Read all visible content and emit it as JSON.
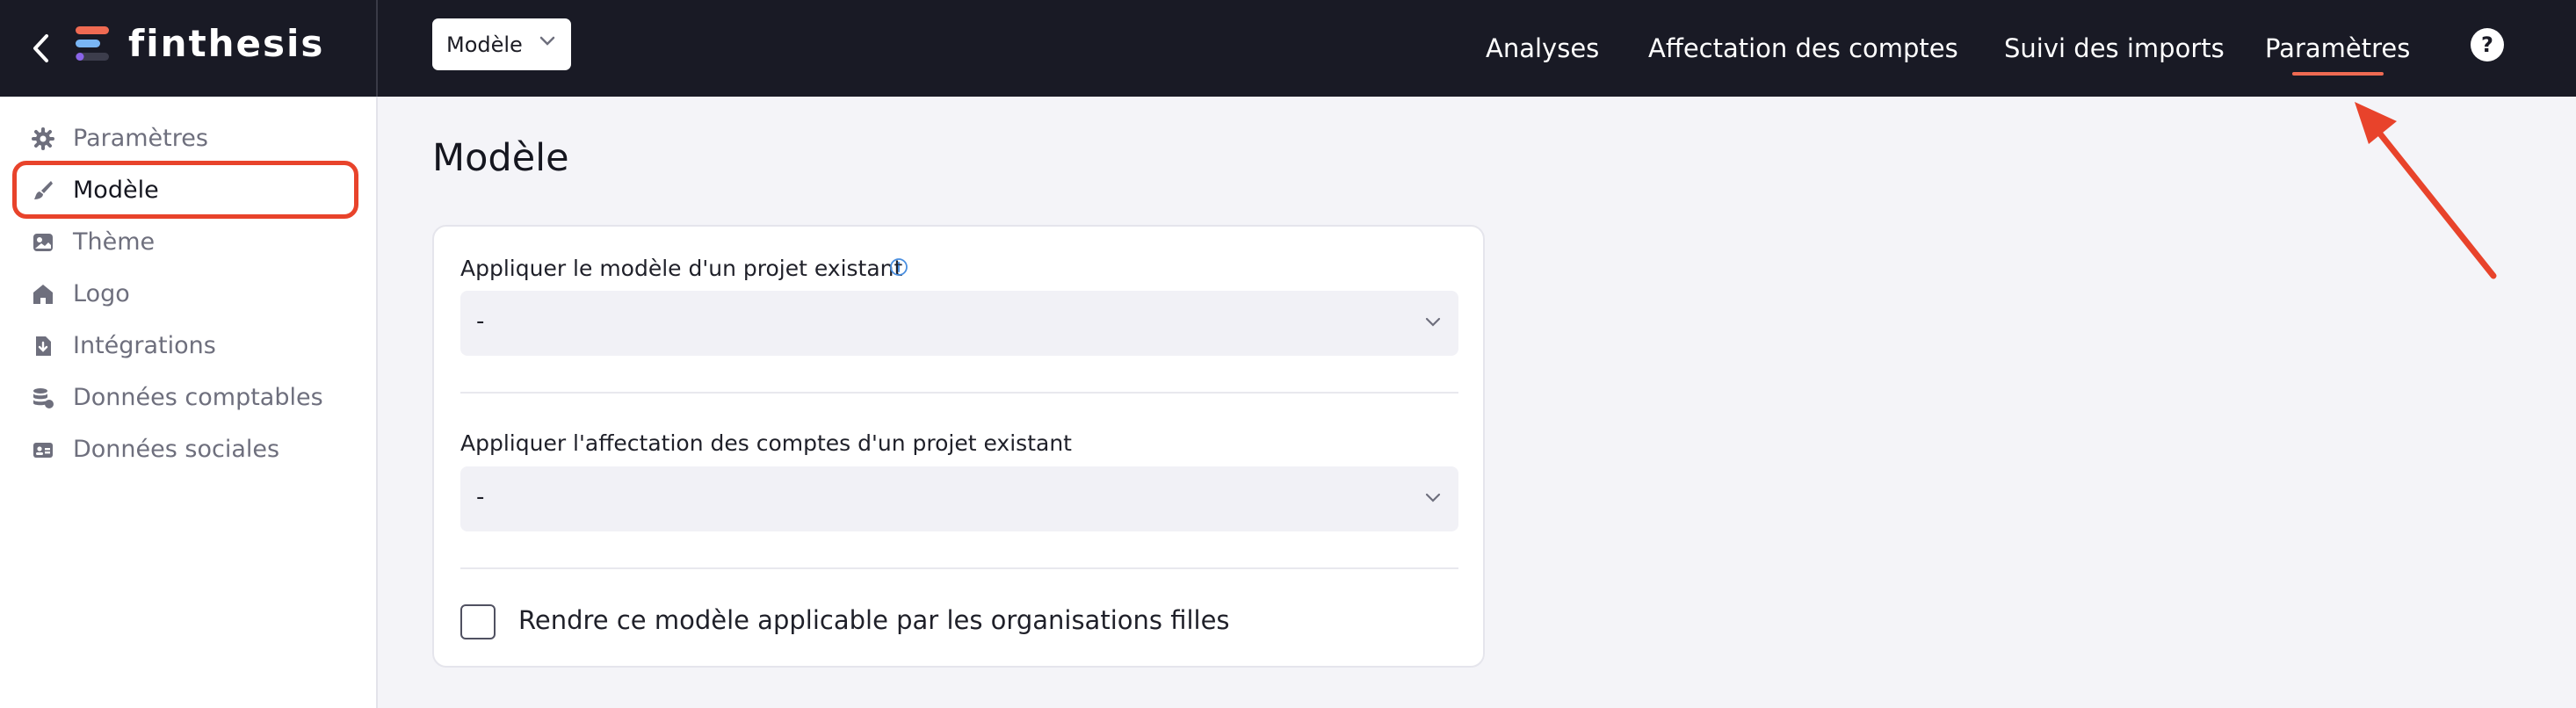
{
  "brand": {
    "name": "finthesis"
  },
  "header": {
    "model_select": "Modèle",
    "nav": [
      {
        "label": "Analyses"
      },
      {
        "label": "Affectation des comptes"
      },
      {
        "label": "Suivi des imports"
      },
      {
        "label": "Paramètres",
        "active": true
      }
    ],
    "help": "?"
  },
  "sidebar": {
    "items": [
      {
        "label": "Paramètres",
        "icon": "gear-icon"
      },
      {
        "label": "Modèle",
        "icon": "brush-icon",
        "active": true
      },
      {
        "label": "Thème",
        "icon": "image-icon"
      },
      {
        "label": "Logo",
        "icon": "home-icon"
      },
      {
        "label": "Intégrations",
        "icon": "download-file-icon"
      },
      {
        "label": "Données comptables",
        "icon": "database-icon"
      },
      {
        "label": "Données sociales",
        "icon": "id-card-icon"
      }
    ]
  },
  "main": {
    "title": "Modèle",
    "apply_model": {
      "label": "Appliquer le modèle d'un projet existant",
      "value": "-"
    },
    "apply_accounts": {
      "label": "Appliquer l'affectation des comptes d'un projet existant",
      "value": "-"
    },
    "checkbox": {
      "label": "Rendre ce modèle applicable par les organisations filles",
      "checked": false
    }
  },
  "colors": {
    "topbar": "#191a25",
    "accent": "#ef6a52",
    "annotation": "#e8432b"
  }
}
